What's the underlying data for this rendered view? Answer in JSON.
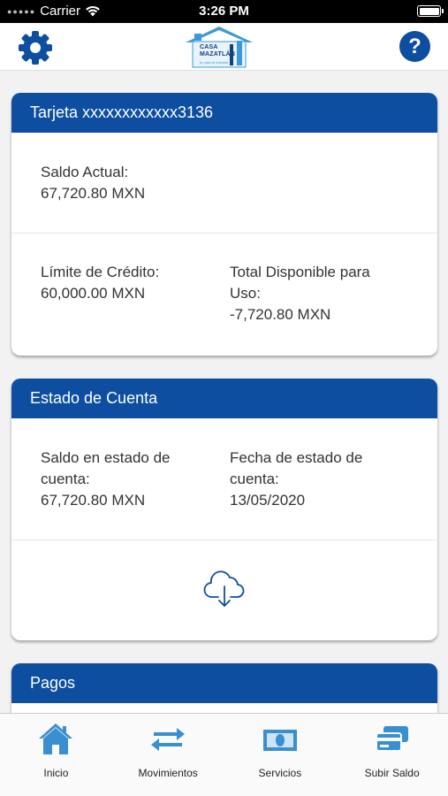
{
  "status_bar": {
    "carrier": "Carrier",
    "time": "3:26 PM"
  },
  "header": {
    "logo_line1": "CASA",
    "logo_line2": "MAZATLÁN",
    "logo_tagline": "tu casa al instante",
    "help_label": "?"
  },
  "card_account": {
    "title": "Tarjeta xxxxxxxxxxxx3136",
    "saldo_label": "Saldo Actual:",
    "saldo_value": "67,720.80 MXN",
    "limite_label": "Límite de Crédito:",
    "limite_value": "60,000.00 MXN",
    "disponible_label_1": "Total Disponible para",
    "disponible_label_2": "Uso:",
    "disponible_value": "-7,720.80 MXN"
  },
  "card_statement": {
    "title": "Estado de Cuenta",
    "saldo_label_1": "Saldo en estado de",
    "saldo_label_2": "cuenta:",
    "saldo_value": "67,720.80 MXN",
    "fecha_label_1": "Fecha de estado de",
    "fecha_label_2": "cuenta:",
    "fecha_value": "13/05/2020"
  },
  "card_payments": {
    "title": "Pagos"
  },
  "tab_bar": {
    "items": [
      {
        "label": "Inicio",
        "icon": "home-icon"
      },
      {
        "label": "Movimientos",
        "icon": "transfer-arrows-icon"
      },
      {
        "label": "Servicios",
        "icon": "banknote-icon"
      },
      {
        "label": "Subir Saldo",
        "icon": "cards-icon"
      }
    ]
  },
  "colors": {
    "primary": "#0d4ea0",
    "icon_blue": "#3a8fd0",
    "background": "#f2f2f2"
  }
}
